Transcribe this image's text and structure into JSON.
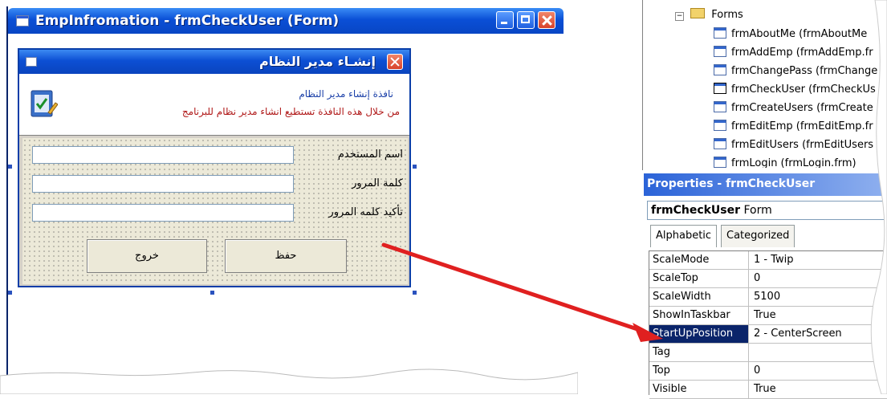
{
  "designer": {
    "title": "EmpInfromation - frmCheckUser (Form)"
  },
  "form": {
    "title": "إنشـاء مدير النظام",
    "header_line1": "نافذة إنشاء مدير النظام",
    "header_line2": "من خلال هذه النافذة تستطيع انشاء مدير نظام للبرنامج",
    "fields": [
      {
        "label": "اسم المستخدم"
      },
      {
        "label": "كلمة المرور"
      },
      {
        "label": "تأكيد كلمه المرور"
      }
    ],
    "save_label": "حفظ",
    "exit_label": "خروج"
  },
  "tree": {
    "folder": "Forms",
    "items": [
      "frmAboutMe (frmAboutMe",
      "frmAddEmp (frmAddEmp.fr",
      "frmChangePass (frmChange",
      "frmCheckUser (frmCheckUs",
      "frmCreateUsers (frmCreate",
      "frmEditEmp (frmEditEmp.fr",
      "frmEditUsers (frmEditUsers",
      "frmLogin (frmLogin.frm)"
    ]
  },
  "properties": {
    "title": "Properties - frmCheckUser",
    "object_name": "frmCheckUser",
    "object_type": "Form",
    "tab_alphabetic": "Alphabetic",
    "tab_categorized": "Categorized",
    "rows": [
      {
        "key": "ScaleMode",
        "value": "1 - Twip"
      },
      {
        "key": "ScaleTop",
        "value": "0"
      },
      {
        "key": "ScaleWidth",
        "value": "5100"
      },
      {
        "key": "ShowInTaskbar",
        "value": "True"
      },
      {
        "key": "StartUpPosition",
        "value": "2 - CenterScreen"
      },
      {
        "key": "Tag",
        "value": ""
      },
      {
        "key": "Top",
        "value": "0"
      },
      {
        "key": "Visible",
        "value": "True"
      }
    ]
  },
  "colors": {
    "xp_title": "#0a4fd6",
    "arrow": "#e02020",
    "selected_row": "#0a246a"
  }
}
